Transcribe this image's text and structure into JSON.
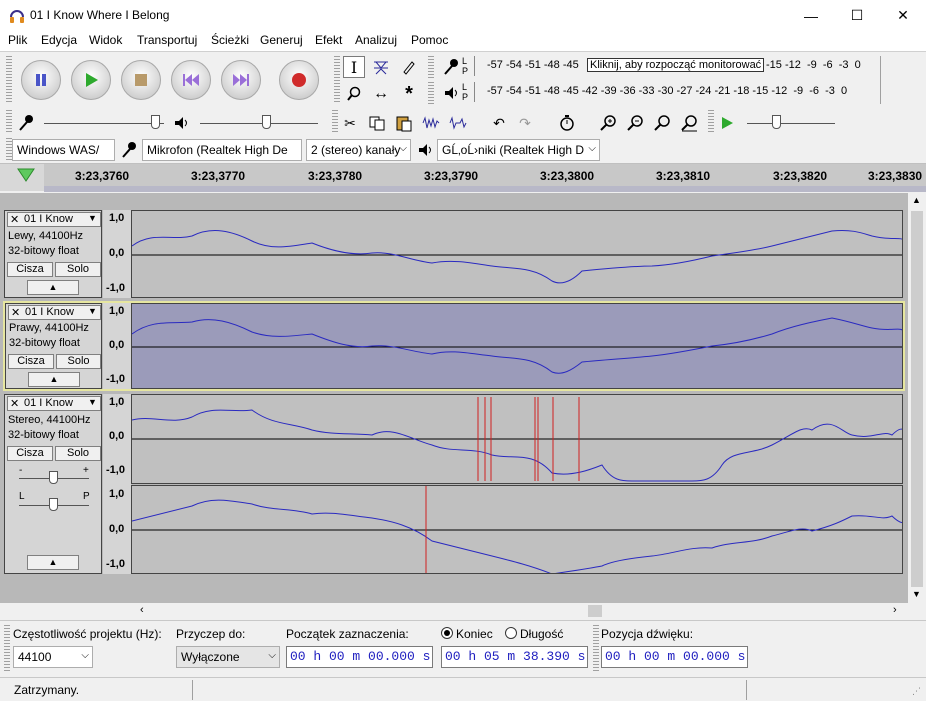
{
  "window": {
    "title": "01 I Know Where I Belong",
    "minimize_glyph": "—",
    "maximize_glyph": "☐",
    "close_glyph": "✕"
  },
  "menu": [
    "Plik",
    "Edycja",
    "Widok",
    "Transportuj",
    "Ścieżki",
    "Generuj",
    "Efekt",
    "Analizuj",
    "Pomoc"
  ],
  "meters": {
    "record_channels": "L\nP",
    "playback_channels": "L\nP",
    "record_scale_left": "-57 -54 -51 -48 -45",
    "record_prompt": "Kliknij, aby rozpocząć monitorować",
    "record_scale_right": "-15 -12  -9  -6  -3  0",
    "playback_scale": "-57 -54 -51 -48 -45 -42 -39 -36 -33 -30 -27 -24 -21 -18 -15 -12  -9  -6  -3  0"
  },
  "device": {
    "host": "Windows WAS/",
    "mic": "Mikrofon (Realtek High De",
    "channels": "2 (stereo) kanały",
    "speakers": "GĹ‚oĹ›niki (Realtek High D"
  },
  "ruler": {
    "ticks": [
      "3:23,3760",
      "3:23,3770",
      "3:23,3780",
      "3:23,3790",
      "3:23,3800",
      "3:23,3810",
      "3:23,3820",
      "3:23,3830"
    ]
  },
  "tracks": [
    {
      "name": "01 I Know",
      "info1": "Lewy, 44100Hz",
      "info2": "32-bitowy float",
      "mute": "Cisza",
      "solo": "Solo",
      "scale": [
        "1,0",
        "0,0",
        "-1,0"
      ]
    },
    {
      "name": "01 I Know",
      "info1": "Prawy, 44100Hz",
      "info2": "32-bitowy float",
      "mute": "Cisza",
      "solo": "Solo",
      "scale": [
        "1,0",
        "0,0",
        "-1,0"
      ]
    },
    {
      "name": "01 I Know",
      "info1": "Stereo, 44100Hz",
      "info2": "32-bitowy float",
      "mute": "Cisza",
      "solo": "Solo",
      "gain_minus": "-",
      "gain_plus": "+",
      "pan_left": "L",
      "pan_right": "P",
      "scale_top": [
        "1,0",
        "0,0",
        "-1,0"
      ],
      "scale_bottom": [
        "1,0",
        "0,0",
        "-1,0"
      ]
    }
  ],
  "selection_bar": {
    "rate_label": "Częstotliwość projektu (Hz):",
    "rate_value": "44100",
    "snap_label": "Przyczep do:",
    "snap_value": "Wyłączone",
    "start_label": "Początek zaznaczenia:",
    "start_value": "00 h 00 m 00.000 s",
    "end_option": "Koniec",
    "length_option": "Długość",
    "end_value": "00 h 05 m 38.390 s",
    "pos_label": "Pozycja dźwięku:",
    "pos_value": "00 h 00 m 00.000 s"
  },
  "status": "Zatrzymany."
}
